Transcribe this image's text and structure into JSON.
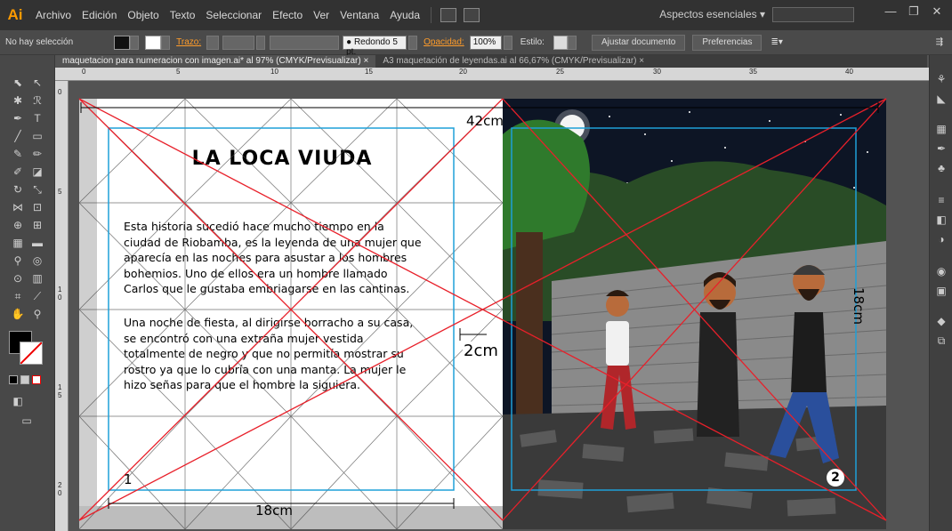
{
  "menubar": {
    "logo": "Ai",
    "items": [
      "Archivo",
      "Edición",
      "Objeto",
      "Texto",
      "Seleccionar",
      "Efecto",
      "Ver",
      "Ventana",
      "Ayuda"
    ],
    "workspace": "Aspectos esenciales"
  },
  "controlbar": {
    "selection": "No hay selección",
    "stroke_label": "Trazo:",
    "brush": "Redondo 5 pt.",
    "opacity_label": "Opacidad:",
    "opacity_value": "100%",
    "style_label": "Estilo:",
    "fit_button": "Ajustar documento",
    "prefs_button": "Preferencias"
  },
  "tabs": [
    "maquetacion para numeracion con imagen.ai* al 97% (CMYK/Previsualizar)",
    "A3 maquetación de leyendas.ai al 66,67% (CMYK/Previsualizar)"
  ],
  "ruler": {
    "h_ticks": [
      "0",
      "5",
      "10",
      "15",
      "20",
      "25",
      "30",
      "35",
      "40"
    ],
    "v_ticks": [
      "0",
      "5",
      "1\n0",
      "1\n5",
      "2\n0"
    ]
  },
  "document": {
    "title": "LA LOCA VIUDA",
    "paragraph1": "Esta historia sucedió hace mucho tiempo en la ciudad de Riobamba, es la leyenda de una mujer que aparecía en las noches para asustar a los hombres bohemios. Uno de ellos era un hombre llamado Carlos que le gustaba embriagarse en las cantinas.",
    "paragraph2": "Una noche de fiesta, al dirigirse borracho a su casa, se encontró con una extraña mujer vestida totalmente de negro y que no permitía mostrar su rostro ya que lo cubría con una manta. La mujer le hizo señas para que el hombre la siguiera.",
    "dim_top": "42cm",
    "dim_bottom": "18cm",
    "dim_right": "18cm",
    "dim_gap": "2cm",
    "page1": "1",
    "page2": "2"
  },
  "colors": {
    "guide_red": "#e8202a",
    "margin_cyan": "#1ea0d8",
    "ai_orange": "#ff9a00"
  }
}
